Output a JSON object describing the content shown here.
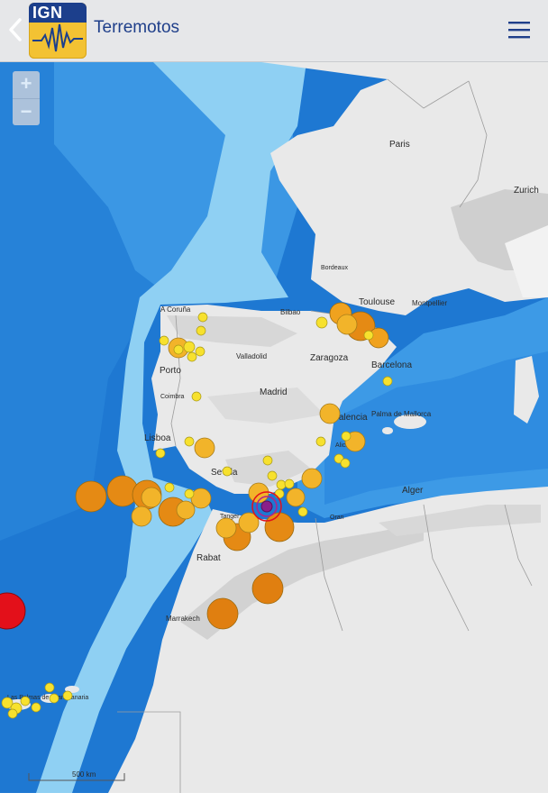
{
  "app": {
    "title": "Terremotos",
    "logo_text": "IGN"
  },
  "zoom": {
    "in_label": "+",
    "out_label": "−"
  },
  "icons": {
    "back": "chevron-left-icon",
    "menu": "hamburger-menu-icon"
  },
  "map": {
    "cities": {
      "paris": "Paris",
      "zurich": "Zurich",
      "bordeaux": "Bordeaux",
      "toulouse": "Toulouse",
      "montpellier": "Montpellier",
      "bilbao": "Bilbao",
      "acoruna": "A Coruña",
      "valladolid": "Valladolid",
      "zaragoza": "Zaragoza",
      "barcelona": "Barcelona",
      "porto": "Porto",
      "coimbra": "Coimbra",
      "madrid": "Madrid",
      "palma": "Palma de Mallorca",
      "valencia": "Valencia",
      "lisboa": "Lisboa",
      "alicante": "Alicante",
      "sevilla": "Sevilla",
      "alger": "Alger",
      "tanger": "Tanger",
      "oran": "Oran",
      "rabat": "Rabat",
      "marrakech": "Marrakech",
      "laspalmas": "Las Palmas de Gran Canaria"
    },
    "scale_label": "500 km",
    "colors": {
      "deep_sea": "#1e78d2",
      "sea": "#3d9ae6",
      "shelf": "#8fd0f3",
      "land": "#e9e9e9",
      "quake_yellow": "#f7e12e",
      "quake_orange": "#f0a21e",
      "quake_dark_orange": "#e07f10",
      "quake_red": "#e3101a",
      "quake_purple": "#8a1f8a"
    }
  }
}
